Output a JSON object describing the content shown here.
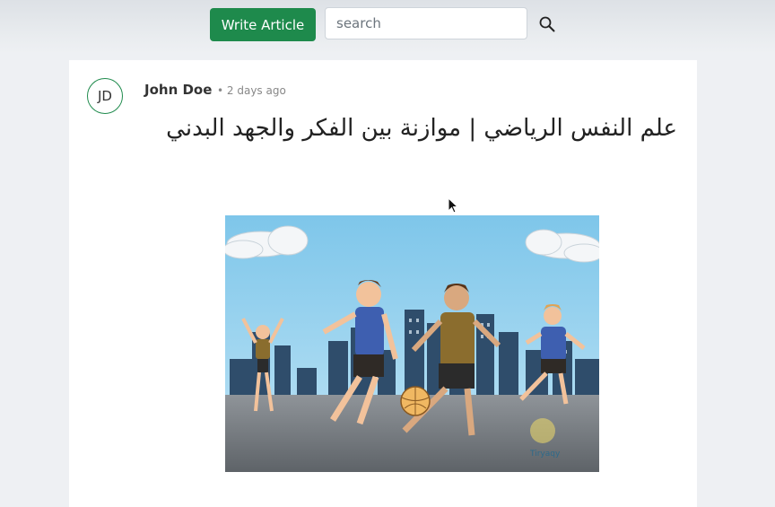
{
  "header": {
    "write_label": "Write Article",
    "search_placeholder": "search"
  },
  "post": {
    "avatar_initials": "JD",
    "author": "John Doe",
    "time": "• 2 days ago",
    "title": "علم النفس الرياضي | موازنة بين الفكر والجهد البدني",
    "image_logo": "Tiryaqy"
  },
  "colors": {
    "accent": "#1e8a4c",
    "background": "#eef0f3",
    "card": "#ffffff"
  },
  "icons": {
    "search": "magnifier-icon"
  }
}
